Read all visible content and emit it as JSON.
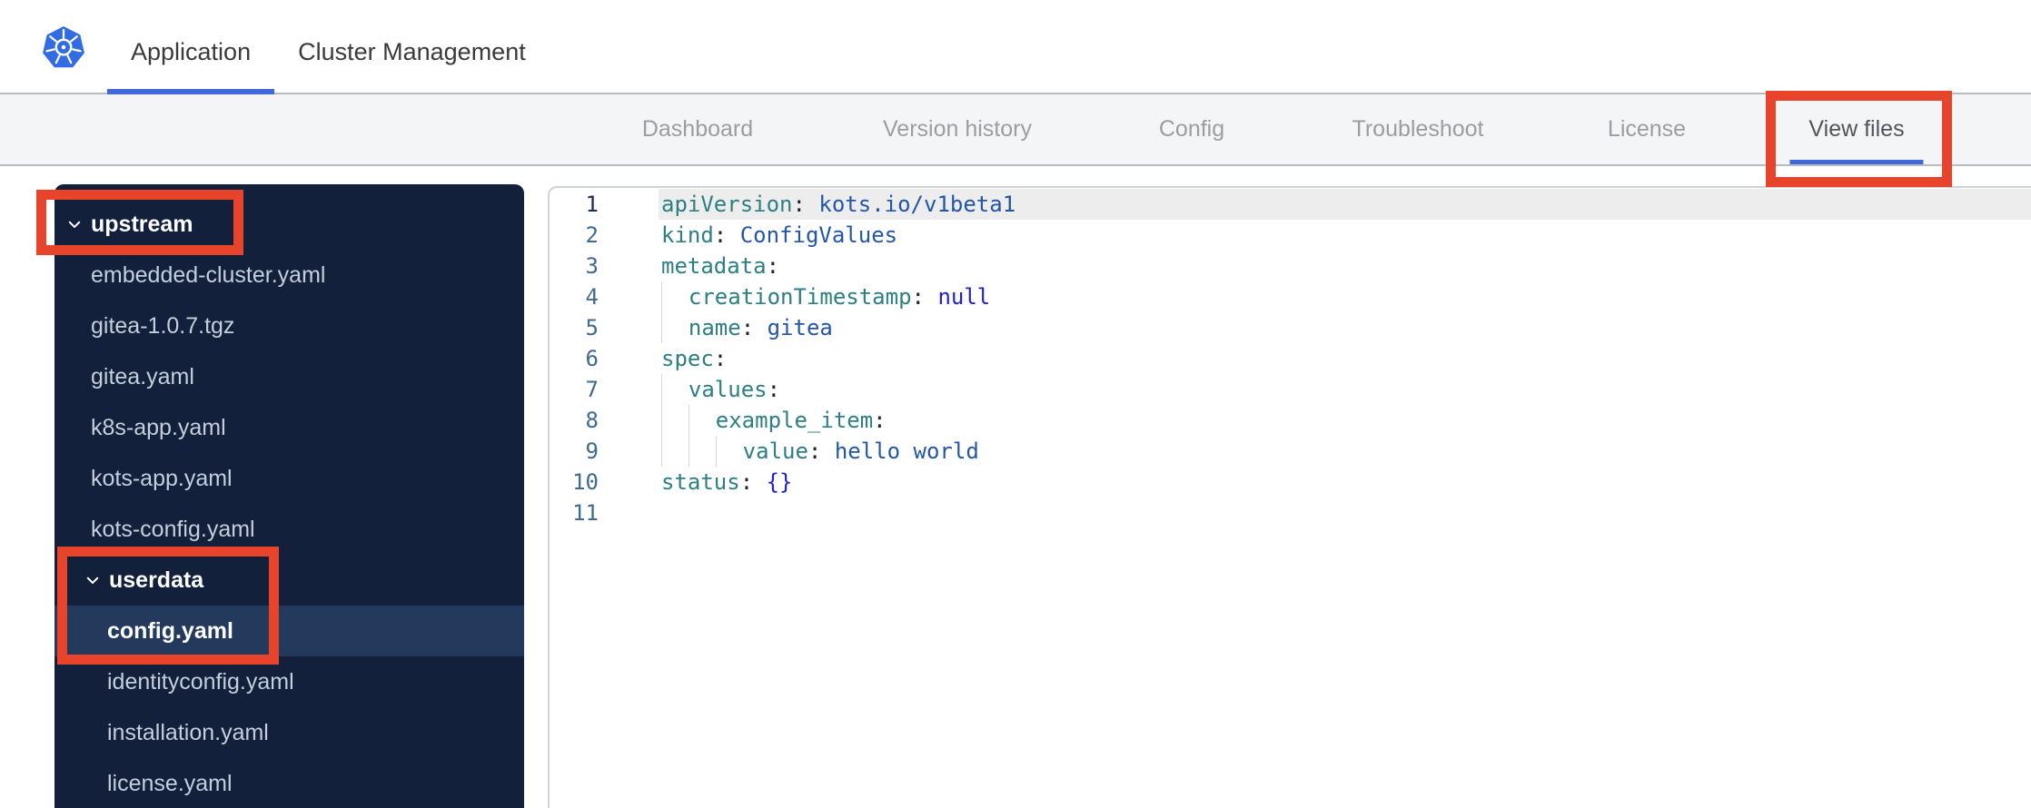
{
  "header": {
    "tabs": [
      {
        "label": "Application",
        "active": true
      },
      {
        "label": "Cluster Management",
        "active": false
      }
    ]
  },
  "subnav": {
    "tabs": [
      {
        "label": "Dashboard",
        "active": false
      },
      {
        "label": "Version history",
        "active": false
      },
      {
        "label": "Config",
        "active": false
      },
      {
        "label": "Troubleshoot",
        "active": false
      },
      {
        "label": "License",
        "active": false
      },
      {
        "label": "View files",
        "active": true
      }
    ]
  },
  "file_tree": {
    "items": [
      {
        "type": "folder",
        "label": "upstream",
        "level": 0,
        "expanded": true,
        "selected": false
      },
      {
        "type": "file",
        "label": "embedded-cluster.yaml",
        "level": 1,
        "selected": false
      },
      {
        "type": "file",
        "label": "gitea-1.0.7.tgz",
        "level": 1,
        "selected": false
      },
      {
        "type": "file",
        "label": "gitea.yaml",
        "level": 1,
        "selected": false
      },
      {
        "type": "file",
        "label": "k8s-app.yaml",
        "level": 1,
        "selected": false
      },
      {
        "type": "file",
        "label": "kots-app.yaml",
        "level": 1,
        "selected": false
      },
      {
        "type": "file",
        "label": "kots-config.yaml",
        "level": 1,
        "selected": false
      },
      {
        "type": "folder",
        "label": "userdata",
        "level": 1,
        "expanded": true,
        "selected": false
      },
      {
        "type": "file",
        "label": "config.yaml",
        "level": 2,
        "selected": true
      },
      {
        "type": "file",
        "label": "identityconfig.yaml",
        "level": 2,
        "selected": false
      },
      {
        "type": "file",
        "label": "installation.yaml",
        "level": 2,
        "selected": false
      },
      {
        "type": "file",
        "label": "license.yaml",
        "level": 2,
        "selected": false
      }
    ]
  },
  "editor": {
    "language": "yaml",
    "lines": [
      {
        "num": 1,
        "indent": 0,
        "active": true,
        "tokens": [
          [
            "k",
            "apiVersion"
          ],
          [
            "p",
            ": "
          ],
          [
            "v",
            "kots.io/v1beta1"
          ]
        ]
      },
      {
        "num": 2,
        "indent": 0,
        "active": false,
        "tokens": [
          [
            "k",
            "kind"
          ],
          [
            "p",
            ": "
          ],
          [
            "v",
            "ConfigValues"
          ]
        ]
      },
      {
        "num": 3,
        "indent": 0,
        "active": false,
        "tokens": [
          [
            "k",
            "metadata"
          ],
          [
            "p",
            ":"
          ]
        ]
      },
      {
        "num": 4,
        "indent": 1,
        "active": false,
        "tokens": [
          [
            "k",
            "creationTimestamp"
          ],
          [
            "p",
            ": "
          ],
          [
            "a",
            "null"
          ]
        ]
      },
      {
        "num": 5,
        "indent": 1,
        "active": false,
        "tokens": [
          [
            "k",
            "name"
          ],
          [
            "p",
            ": "
          ],
          [
            "v",
            "gitea"
          ]
        ]
      },
      {
        "num": 6,
        "indent": 0,
        "active": false,
        "tokens": [
          [
            "k",
            "spec"
          ],
          [
            "p",
            ":"
          ]
        ]
      },
      {
        "num": 7,
        "indent": 1,
        "active": false,
        "tokens": [
          [
            "k",
            "values"
          ],
          [
            "p",
            ":"
          ]
        ]
      },
      {
        "num": 8,
        "indent": 2,
        "active": false,
        "tokens": [
          [
            "k",
            "example_item"
          ],
          [
            "p",
            ":"
          ]
        ]
      },
      {
        "num": 9,
        "indent": 3,
        "active": false,
        "tokens": [
          [
            "k",
            "value"
          ],
          [
            "p",
            ": "
          ],
          [
            "v",
            "hello world"
          ]
        ]
      },
      {
        "num": 10,
        "indent": 0,
        "active": false,
        "tokens": [
          [
            "k",
            "status"
          ],
          [
            "p",
            ": "
          ],
          [
            "a",
            "{}"
          ]
        ]
      },
      {
        "num": 11,
        "indent": 0,
        "active": false,
        "tokens": []
      }
    ]
  },
  "annotations": [
    {
      "target": "upstream-folder"
    },
    {
      "target": "userdata-and-config-yaml"
    },
    {
      "target": "view-files-tab"
    }
  ],
  "icons": {
    "logo": "kubernetes-logo",
    "folder_chevron": "chevron-down-icon"
  },
  "colors": {
    "accent_blue": "#3F69D9",
    "kubernetes_blue": "#326CE5",
    "annotation_red": "#E8432B",
    "sidebar_bg": "#13203C",
    "sidebar_selected_bg": "#233A5C",
    "subnav_bg": "#F4F5F7",
    "syntax_key": "#2E7F82",
    "syntax_value": "#2456A8",
    "syntax_atom": "#2121CC",
    "active_line_bg": "#EDEDED"
  }
}
